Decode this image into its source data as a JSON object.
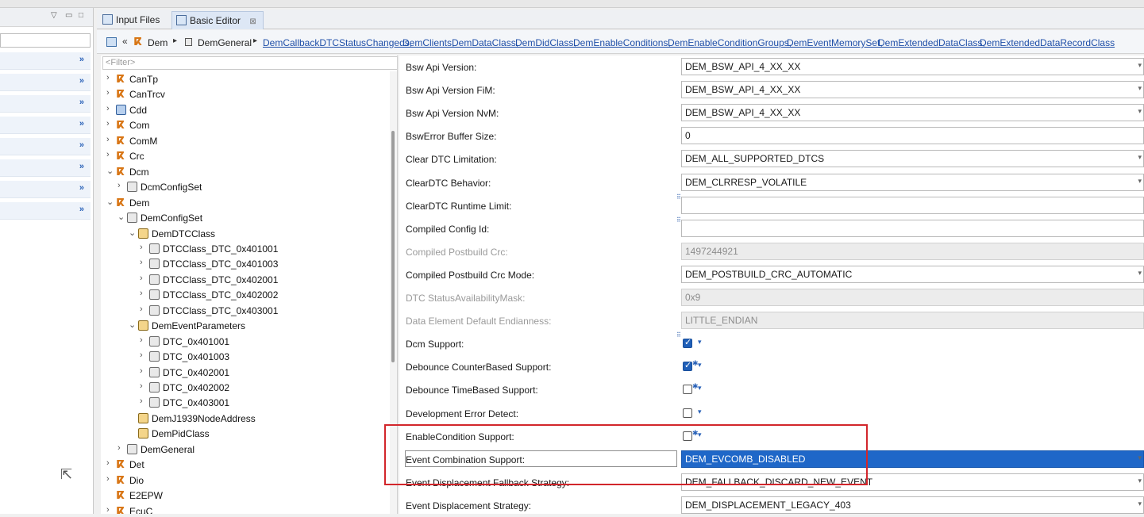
{
  "tabs": [
    {
      "label": "Input Files"
    },
    {
      "label": "Basic Editor",
      "close": "⊠"
    }
  ],
  "breadcrumb": {
    "path": [
      "Dem",
      "DemGeneral"
    ],
    "links": [
      "DemCallbackDTCStatusChangeds,",
      "DemClients,",
      "DemDataClass,",
      "DemDidClass,",
      "DemEnableConditions,",
      "DemEnableConditionGroups,",
      "DemEventMemorySet,",
      "DemExtendedDataClass,",
      "DemExtendedDataRecordClass"
    ]
  },
  "tree": {
    "filter_placeholder": "<Filter>",
    "nodes": [
      {
        "label": "CanTp",
        "level": 0,
        "twisty": "›",
        "icon": "module-icon"
      },
      {
        "label": "CanTrcv",
        "level": 0,
        "twisty": "›",
        "icon": "module-icon"
      },
      {
        "label": "Cdd",
        "level": 0,
        "twisty": "›",
        "icon": "cdd-icon"
      },
      {
        "label": "Com",
        "level": 0,
        "twisty": "›",
        "icon": "module-icon"
      },
      {
        "label": "ComM",
        "level": 0,
        "twisty": "›",
        "icon": "module-icon"
      },
      {
        "label": "Crc",
        "level": 0,
        "twisty": "›",
        "icon": "module-icon"
      },
      {
        "label": "Dcm",
        "level": 0,
        "twisty": "⌄",
        "icon": "module-icon"
      },
      {
        "label": "DcmConfigSet",
        "level": 1,
        "twisty": "›",
        "icon": "container-icon"
      },
      {
        "label": "Dem",
        "level": 0,
        "twisty": "⌄",
        "icon": "module-icon"
      },
      {
        "label": "DemConfigSet",
        "level": 1,
        "twisty": "⌄",
        "icon": "container-icon"
      },
      {
        "label": "DemDTCClass",
        "level": 2,
        "twisty": "⌄",
        "icon": "folder-icon"
      },
      {
        "label": "DTCClass_DTC_0x401001",
        "level": 3,
        "twisty": "›",
        "icon": "container-icon"
      },
      {
        "label": "DTCClass_DTC_0x401003",
        "level": 3,
        "twisty": "›",
        "icon": "container-icon"
      },
      {
        "label": "DTCClass_DTC_0x402001",
        "level": 3,
        "twisty": "›",
        "icon": "container-icon"
      },
      {
        "label": "DTCClass_DTC_0x402002",
        "level": 3,
        "twisty": "›",
        "icon": "container-icon"
      },
      {
        "label": "DTCClass_DTC_0x403001",
        "level": 3,
        "twisty": "›",
        "icon": "container-icon"
      },
      {
        "label": "DemEventParameters",
        "level": 2,
        "twisty": "⌄",
        "icon": "folder-icon"
      },
      {
        "label": "DTC_0x401001",
        "level": 3,
        "twisty": "›",
        "icon": "container-icon"
      },
      {
        "label": "DTC_0x401003",
        "level": 3,
        "twisty": "›",
        "icon": "container-icon"
      },
      {
        "label": "DTC_0x402001",
        "level": 3,
        "twisty": "›",
        "icon": "container-icon"
      },
      {
        "label": "DTC_0x402002",
        "level": 3,
        "twisty": "›",
        "icon": "container-icon"
      },
      {
        "label": "DTC_0x403001",
        "level": 3,
        "twisty": "›",
        "icon": "container-icon"
      },
      {
        "label": "DemJ1939NodeAddress",
        "level": 2,
        "twisty": "",
        "icon": "folder-icon"
      },
      {
        "label": "DemPidClass",
        "level": 2,
        "twisty": "",
        "icon": "folder-icon"
      },
      {
        "label": "DemGeneral",
        "level": 1,
        "twisty": "›",
        "icon": "container-icon",
        "selected": true
      },
      {
        "label": "Det",
        "level": 0,
        "twisty": "›",
        "icon": "module-icon"
      },
      {
        "label": "Dio",
        "level": 0,
        "twisty": "›",
        "icon": "module-icon"
      },
      {
        "label": "E2EPW",
        "level": 0,
        "twisty": "",
        "icon": "module-icon"
      },
      {
        "label": "EcuC",
        "level": 0,
        "twisty": "›",
        "icon": "module-icon"
      }
    ]
  },
  "properties": [
    {
      "label": "Bsw Api Version:",
      "type": "combo",
      "value": "DEM_BSW_API_4_XX_XX"
    },
    {
      "label": "Bsw Api Version FiM:",
      "type": "combo",
      "value": "DEM_BSW_API_4_XX_XX"
    },
    {
      "label": "Bsw Api Version NvM:",
      "type": "combo",
      "value": "DEM_BSW_API_4_XX_XX"
    },
    {
      "label": "BswError Buffer Size:",
      "type": "text",
      "value": "0"
    },
    {
      "label": "Clear DTC Limitation:",
      "type": "combo",
      "value": "DEM_ALL_SUPPORTED_DTCS"
    },
    {
      "label": "ClearDTC Behavior:",
      "type": "combo",
      "value": "DEM_CLRRESP_VOLATILE"
    },
    {
      "label": "ClearDTC Runtime Limit:",
      "type": "text",
      "value": "",
      "marker": true
    },
    {
      "label": "Compiled Config Id:",
      "type": "text",
      "value": "",
      "marker": true
    },
    {
      "label": "Compiled Postbuild Crc:",
      "type": "text",
      "value": "1497244921",
      "disabled": true
    },
    {
      "label": "Compiled Postbuild Crc Mode:",
      "type": "combo",
      "value": "DEM_POSTBUILD_CRC_AUTOMATIC"
    },
    {
      "label": "DTC StatusAvailabilityMask:",
      "type": "text",
      "value": "0x9",
      "disabled": true
    },
    {
      "label": "Data Element Default Endianness:",
      "type": "text",
      "value": "LITTLE_ENDIAN",
      "disabled": true
    },
    {
      "label": "Dcm Support:",
      "type": "check",
      "checked": true,
      "marker": true
    },
    {
      "label": "Debounce CounterBased Support:",
      "type": "check",
      "checked": true,
      "star": true
    },
    {
      "label": "Debounce TimeBased Support:",
      "type": "check",
      "checked": false,
      "star": true
    },
    {
      "label": "Development Error Detect:",
      "type": "check",
      "checked": false
    },
    {
      "label": "EnableCondition Support:",
      "type": "check",
      "checked": false,
      "star": true
    },
    {
      "label": "Event Combination Support:",
      "type": "combo",
      "value": "DEM_EVCOMB_DISABLED",
      "selected": true,
      "editing": true
    },
    {
      "label": "Event Displacement Fallback Strategy:",
      "type": "combo",
      "value": "DEM_FALLBACK_DISCARD_NEW_EVENT"
    },
    {
      "label": "Event Displacement Strategy:",
      "type": "combo",
      "value": "DEM_DISPLACEMENT_LEGACY_403"
    }
  ]
}
